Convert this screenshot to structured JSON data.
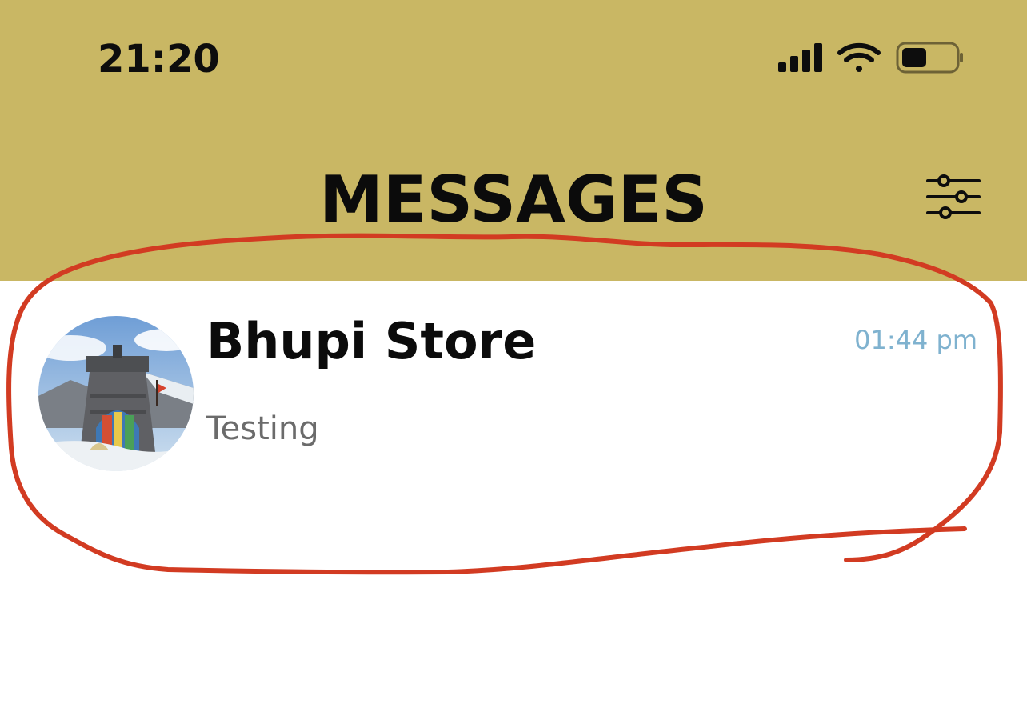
{
  "status_bar": {
    "time": "21:20",
    "icons": [
      "cellular-signal-icon",
      "wifi-icon",
      "battery-icon"
    ]
  },
  "header": {
    "title": "MESSAGES",
    "filter_icon": "sliders-icon",
    "background": "#c9b764"
  },
  "conversations": [
    {
      "name": "Bhupi Store",
      "time": "01:44 pm",
      "preview": "Testing",
      "avatar": "temple-photo-avatar"
    }
  ],
  "colors": {
    "timestamp": "#7fb2cf",
    "annotation": "#d23b22",
    "preview_text": "#6b6b6b"
  }
}
